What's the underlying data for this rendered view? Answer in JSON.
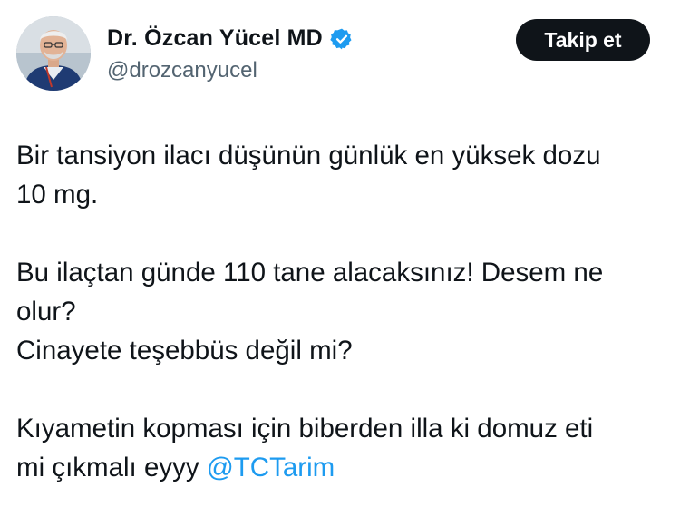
{
  "author": {
    "display_name": "Dr. Özcan Yücel MD",
    "handle": "@drozcanyucel",
    "verified_icon": "verified-badge-icon",
    "badge_color": "#1d9bf0"
  },
  "follow_button": {
    "label": "Takip et"
  },
  "tweet": {
    "line1": "Bir tansiyon ilacı düşünün günlük  en yüksek dozu",
    "line2": "10 mg.",
    "line3": "Bu ilaçtan günde 110 tane alacaksınız! Desem ne",
    "line4": "olur?",
    "line5": "Cinayete teşebbüs değil mi?",
    "line6": "Kıyametin kopması için biberden illa ki domuz eti",
    "line7_prefix": "mi çıkmalı eyyy ",
    "mention": "@TCTarim",
    "mention_color": "#1d9bf0"
  }
}
